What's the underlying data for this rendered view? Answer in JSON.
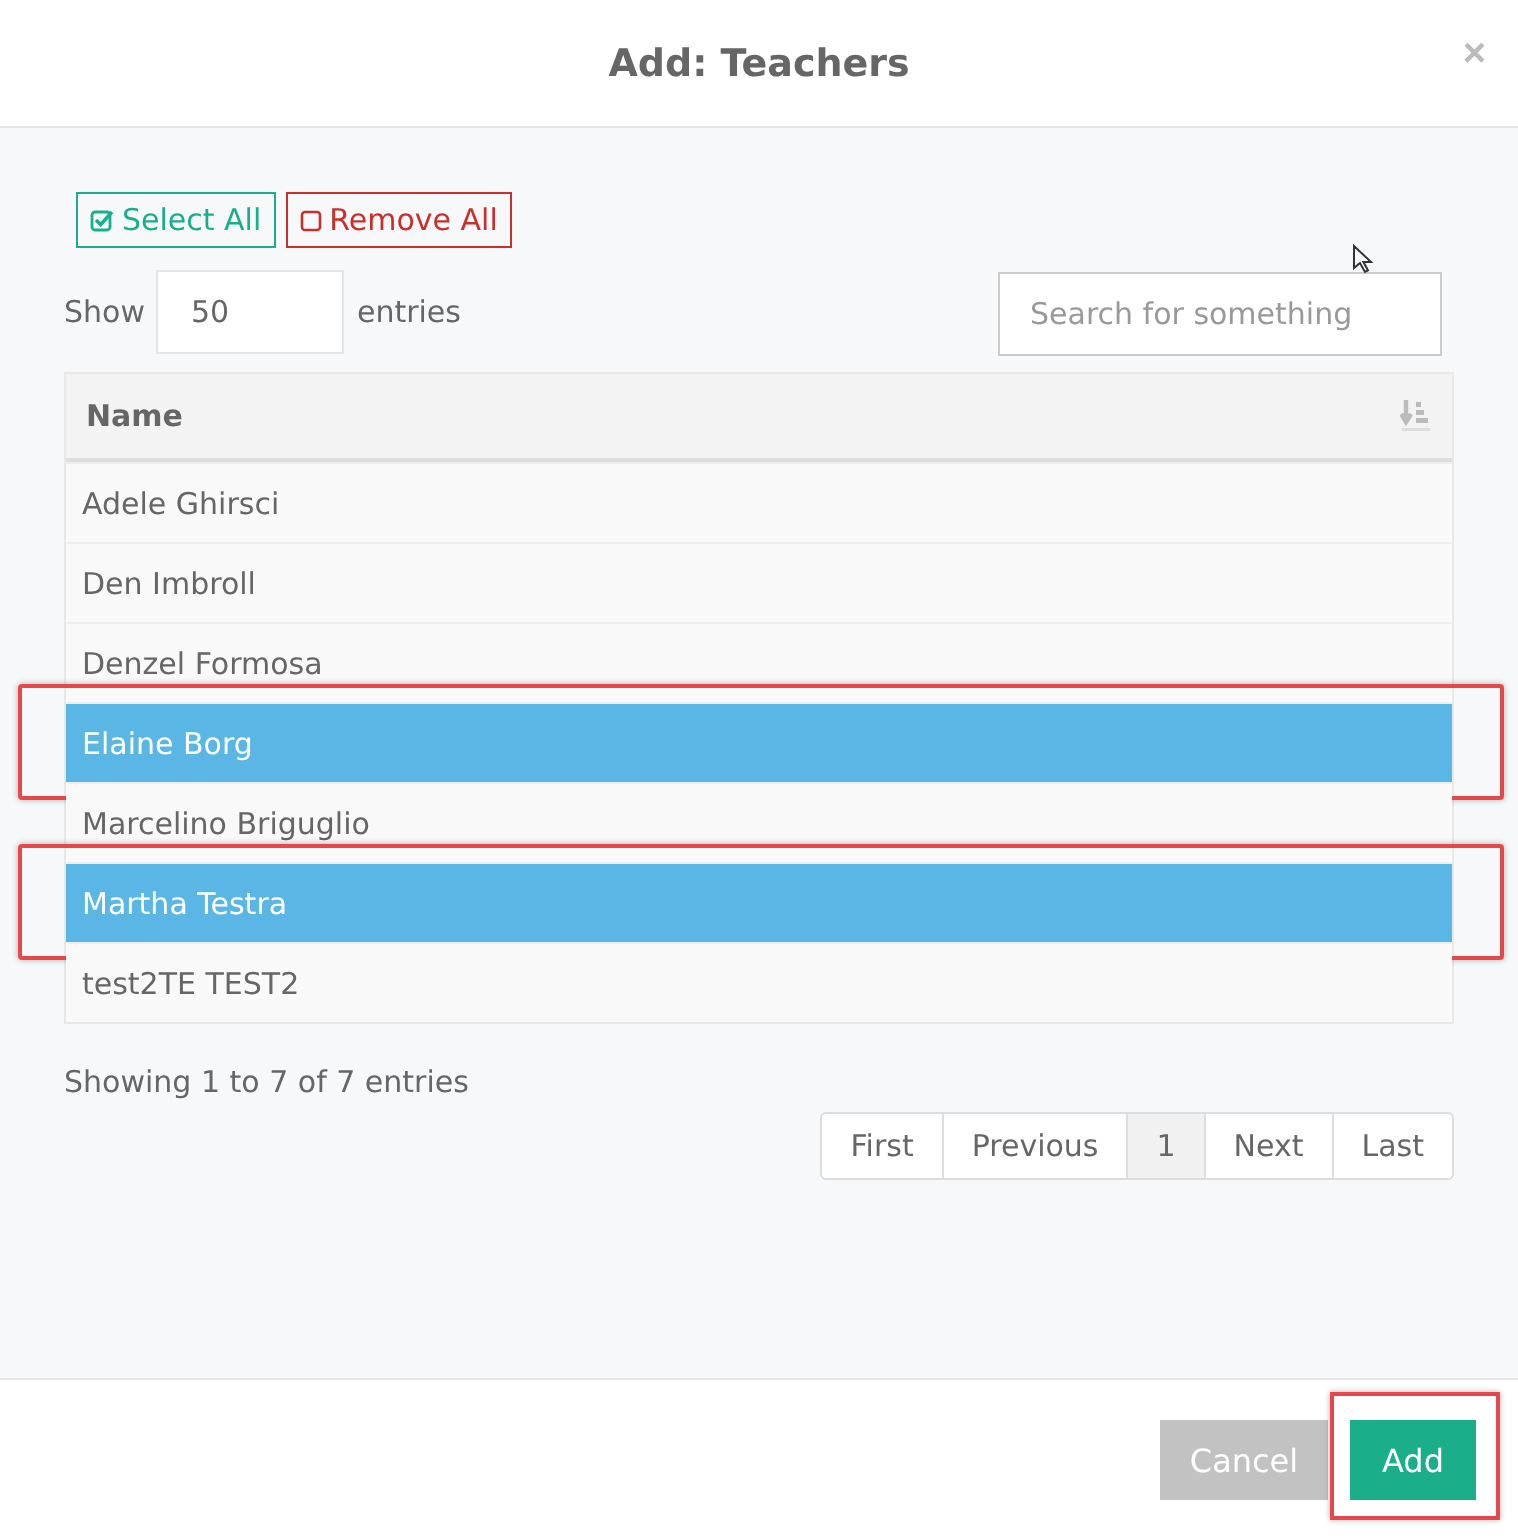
{
  "dialog": {
    "title": "Add: Teachers",
    "close": "×"
  },
  "toolbar": {
    "select_all": "Select All",
    "remove_all": "Remove All"
  },
  "length": {
    "label_before": "Show",
    "value": "50",
    "label_after": "entries"
  },
  "search": {
    "placeholder": "Search for something"
  },
  "table": {
    "columns": [
      "Name"
    ],
    "rows": [
      {
        "name": "Adele Ghirsci",
        "selected": false,
        "highlighted": false
      },
      {
        "name": "Den Imbroll",
        "selected": false,
        "highlighted": false
      },
      {
        "name": "Denzel Formosa",
        "selected": false,
        "highlighted": false
      },
      {
        "name": "Elaine Borg",
        "selected": true,
        "highlighted": true
      },
      {
        "name": "Marcelino Briguglio",
        "selected": false,
        "highlighted": false
      },
      {
        "name": "Martha Testra",
        "selected": true,
        "highlighted": true
      },
      {
        "name": "test2TE TEST2",
        "selected": false,
        "highlighted": false
      }
    ]
  },
  "info": "Showing 1 to 7 of 7 entries",
  "pagination": [
    {
      "label": "First",
      "selected": false
    },
    {
      "label": "Previous",
      "selected": false
    },
    {
      "label": "1",
      "selected": true
    },
    {
      "label": "Next",
      "selected": false
    },
    {
      "label": "Last",
      "selected": false
    }
  ],
  "footer": {
    "cancel": "Cancel",
    "add": {
      "label": "Add",
      "highlighted": true
    }
  }
}
